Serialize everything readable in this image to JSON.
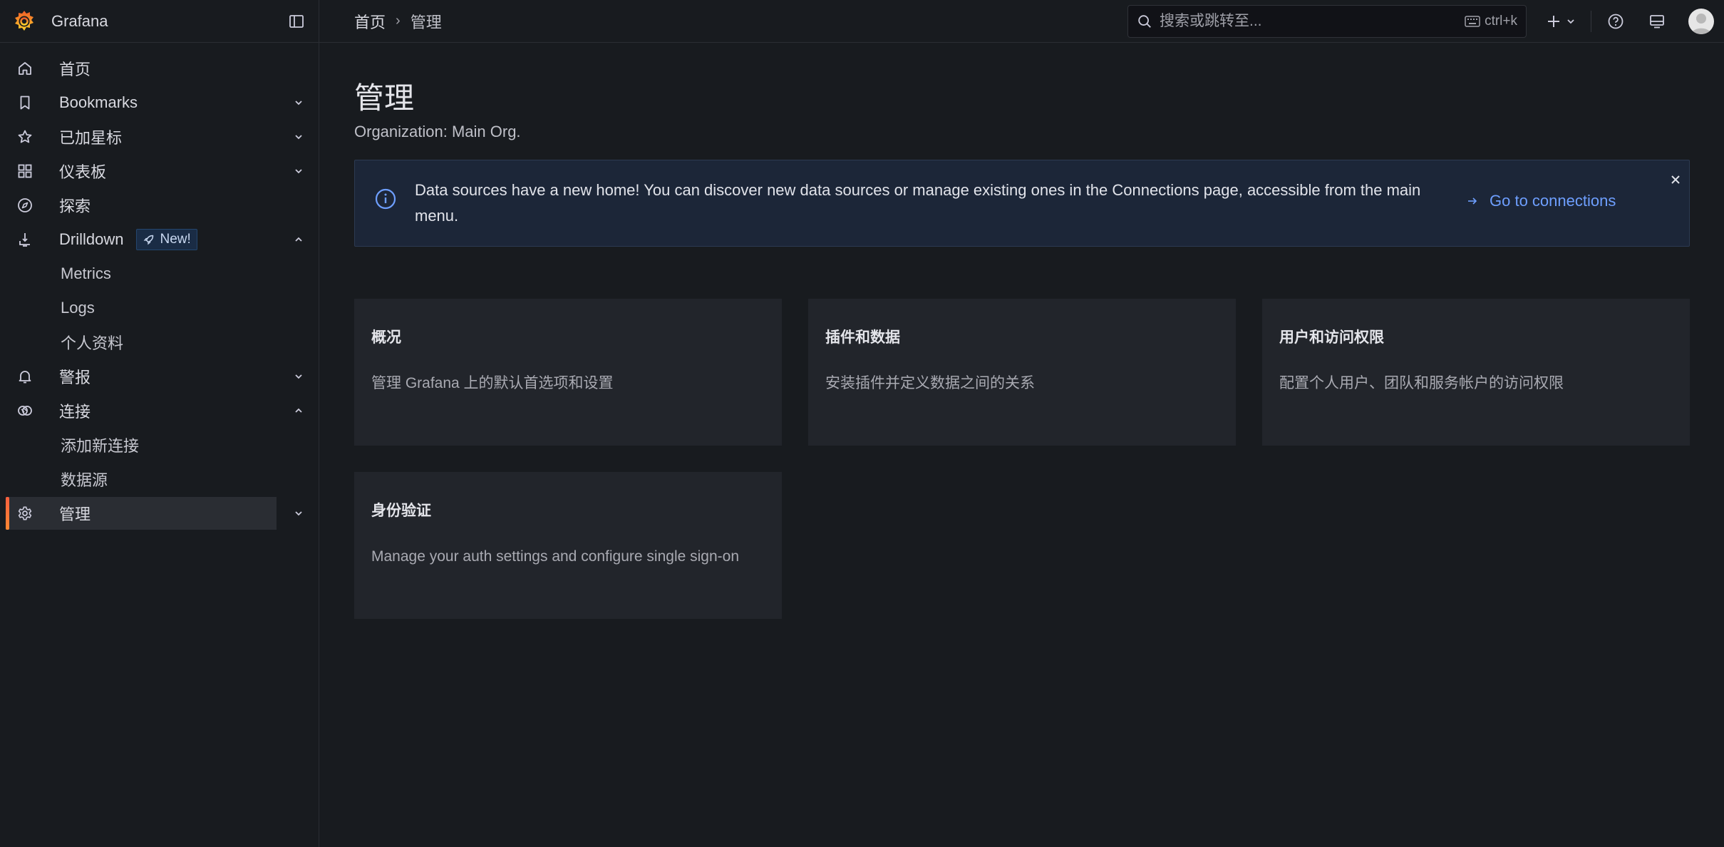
{
  "app": {
    "name": "Grafana",
    "accent": "#f55f3e",
    "link_color": "#6e9fff"
  },
  "breadcrumb": {
    "home": "首页",
    "current": "管理"
  },
  "search": {
    "placeholder": "搜索或跳转至...",
    "shortcut": "ctrl+k"
  },
  "sidebar": {
    "items": [
      {
        "label": "首页",
        "icon": "home-icon"
      },
      {
        "label": "Bookmarks",
        "icon": "bookmark-icon"
      },
      {
        "label": "已加星标",
        "icon": "star-icon"
      },
      {
        "label": "仪表板",
        "icon": "apps-icon"
      },
      {
        "label": "探索",
        "icon": "compass-icon"
      },
      {
        "label": "Drilldown",
        "icon": "drilldown-icon",
        "badge": "New!"
      },
      {
        "label": "Metrics"
      },
      {
        "label": "Logs"
      },
      {
        "label": "个人资料"
      },
      {
        "label": "警报",
        "icon": "bell-icon"
      },
      {
        "label": "连接",
        "icon": "connections-icon"
      },
      {
        "label": "添加新连接"
      },
      {
        "label": "数据源"
      },
      {
        "label": "管理",
        "icon": "cog-icon"
      }
    ]
  },
  "page": {
    "title": "管理",
    "subtitle": "Organization: Main Org."
  },
  "alert": {
    "text": "Data sources have a new home! You can discover new data sources or manage existing ones in the Connections page, accessible from the main menu.",
    "link": "Go to connections"
  },
  "cards": [
    {
      "title": "概况",
      "description": "管理 Grafana 上的默认首选项和设置"
    },
    {
      "title": "插件和数据",
      "description": "安装插件并定义数据之间的关系"
    },
    {
      "title": "用户和访问权限",
      "description": "配置个人用户、团队和服务帐户的访问权限"
    },
    {
      "title": "身份验证",
      "description": "Manage your auth settings and configure single sign-on"
    }
  ]
}
